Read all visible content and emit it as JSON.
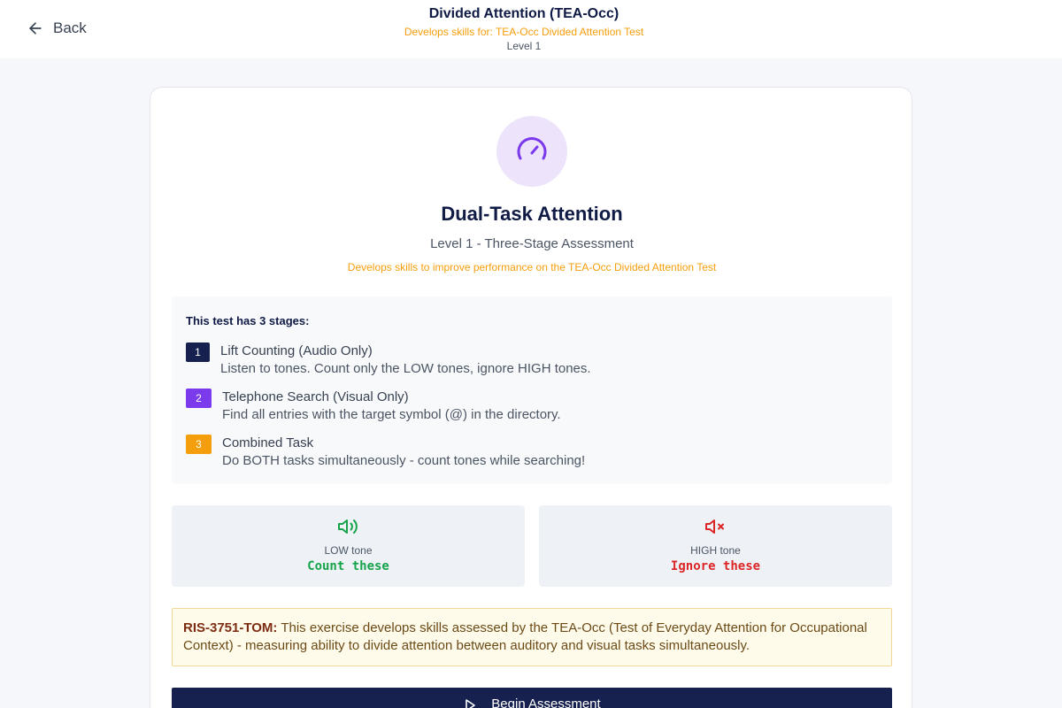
{
  "header": {
    "back_label": "Back",
    "title": "Divided Attention (TEA-Occ)",
    "subtitle": "Develops skills for: TEA-Occ Divided Attention Test",
    "level": "Level 1"
  },
  "card": {
    "icon": "gauge-icon",
    "title": "Dual-Task Attention",
    "subtitle": "Level 1 - Three-Stage Assessment",
    "tagline": "Develops skills to improve performance on the TEA-Occ Divided Attention Test"
  },
  "stages": {
    "heading": "This test has 3 stages:",
    "items": [
      {
        "num": "1",
        "title": "Lift Counting (Audio Only)",
        "desc": "Listen to tones. Count only the LOW tones, ignore HIGH tones.",
        "color": "#16214f"
      },
      {
        "num": "2",
        "title": "Telephone Search (Visual Only)",
        "desc": "Find all entries with the target symbol (@) in the directory.",
        "color": "#7c3aed"
      },
      {
        "num": "3",
        "title": "Combined Task",
        "desc": "Do BOTH tasks simultaneously - count tones while searching!",
        "color": "#f59e0b"
      }
    ]
  },
  "tones": {
    "low": {
      "icon": "speaker-on-icon",
      "label": "LOW tone",
      "action": "Count these",
      "color": "#16a34a"
    },
    "high": {
      "icon": "speaker-muted-icon",
      "label": "HIGH tone",
      "action": "Ignore these",
      "color": "#dc2626"
    }
  },
  "note": {
    "code": "RIS-3751-TOM:",
    "text": "This exercise develops skills assessed by the TEA-Occ (Test of Everyday Attention for Occupational Context) - measuring ability to divide attention between auditory and visual tasks simultaneously."
  },
  "begin_button": {
    "label": "Begin Assessment",
    "icon": "play-icon"
  }
}
